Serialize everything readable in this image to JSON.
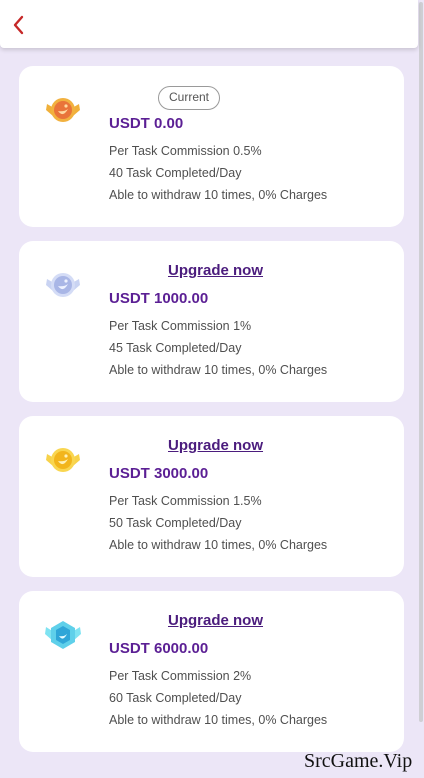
{
  "header": {
    "back_icon": "chevron-left-icon"
  },
  "accent_color": "#5b1f94",
  "cards": [
    {
      "medal_icon": "bronze-medal-icon",
      "badge": "Current",
      "amount": "USDT 0.00",
      "commission": "Per Task Commission 0.5%",
      "tasks": "40 Task Completed/Day",
      "withdraw": "Able to withdraw 10 times, 0% Charges"
    },
    {
      "medal_icon": "silver-medal-icon",
      "action": "Upgrade now",
      "amount": "USDT 1000.00",
      "commission": "Per Task Commission 1%",
      "tasks": "45 Task Completed/Day",
      "withdraw": "Able to withdraw 10 times, 0% Charges"
    },
    {
      "medal_icon": "gold-medal-icon",
      "action": "Upgrade now",
      "amount": "USDT 3000.00",
      "commission": "Per Task Commission 1.5%",
      "tasks": "50 Task Completed/Day",
      "withdraw": "Able to withdraw 10 times, 0% Charges"
    },
    {
      "medal_icon": "diamond-medal-icon",
      "action": "Upgrade now",
      "amount": "USDT 6000.00",
      "commission": "Per Task Commission 2%",
      "tasks": "60 Task Completed/Day",
      "withdraw": "Able to withdraw 10 times, 0% Charges"
    }
  ],
  "watermark": "SrcGame.Vip"
}
